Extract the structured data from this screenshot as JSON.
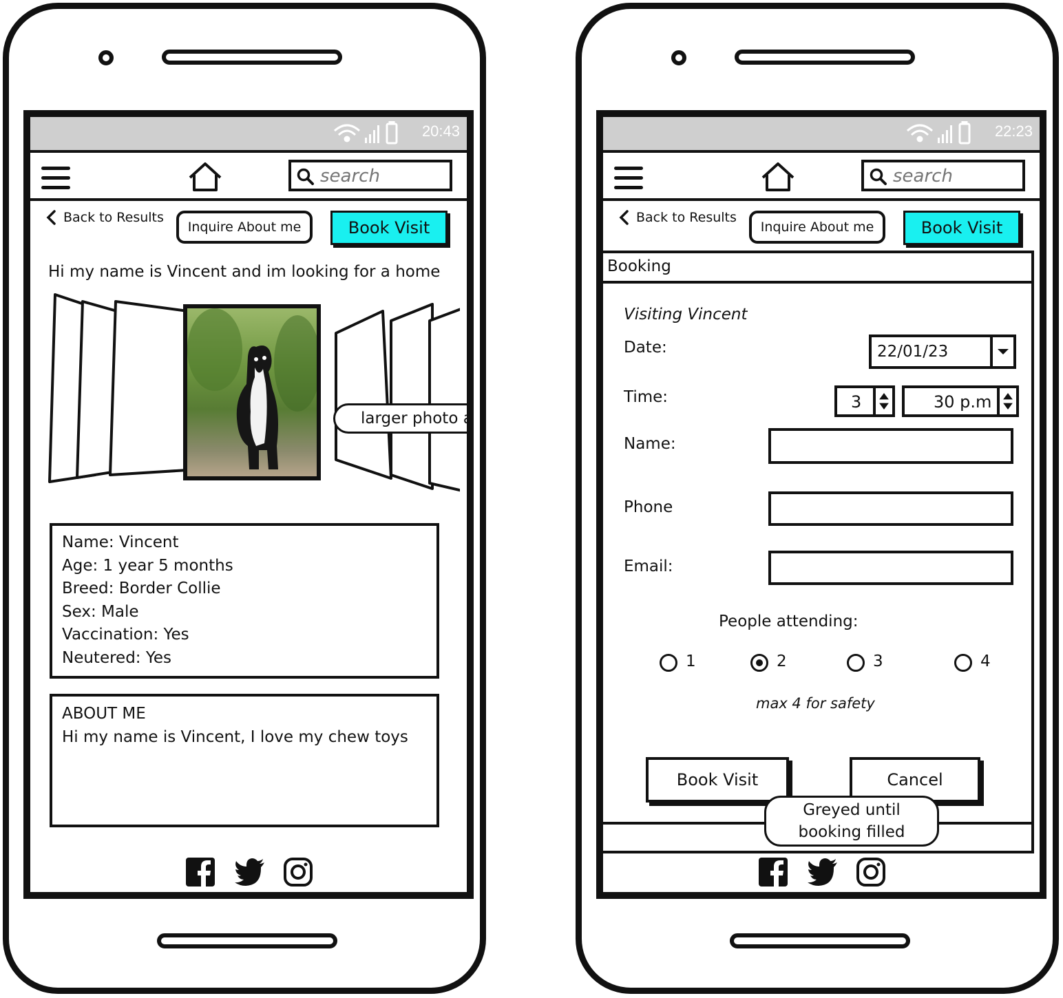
{
  "left_phone": {
    "status_time": "20:43",
    "search_placeholder": "search",
    "back_label": "Back to Results",
    "inquire_label": "Inquire About me",
    "book_label": "Book Visit",
    "headline": "Hi my name is Vincent and im looking for a home",
    "photo_callout": "larger photo area",
    "details": [
      "Name: Vincent",
      "Age: 1 year 5 months",
      "Breed: Border Collie",
      "Sex: Male",
      "Vaccination: Yes",
      "Neutered: Yes"
    ],
    "about_title": "ABOUT ME",
    "about_text": "Hi my name is Vincent, I love my chew toys"
  },
  "right_phone": {
    "status_time": "22:23",
    "search_placeholder": "search",
    "back_label": "Back to Results",
    "inquire_label": "Inquire About me",
    "book_label": "Book Visit",
    "panel_title": "Booking",
    "visiting": "Visiting Vincent",
    "date_label": "Date:",
    "date_value": "22/01/23",
    "time_label": "Time:",
    "time_hour": "3",
    "time_minute": "30 p.m",
    "name_label": "Name:",
    "phone_label": "Phone",
    "email_label": "Email:",
    "people_label": "People attending:",
    "people_options": [
      "1",
      "2",
      "3",
      "4"
    ],
    "people_selected": "2",
    "people_note": "max 4 for safety",
    "book_button": "Book Visit",
    "cancel_button": "Cancel",
    "callout": "Greyed until booking filled"
  },
  "icons": {
    "menu": "hamburger-icon",
    "home": "home-icon",
    "search": "search-icon",
    "back": "chevron-left-icon",
    "wifi": "wifi-icon",
    "signal": "signal-icon",
    "battery": "battery-icon",
    "facebook": "facebook-icon",
    "twitter": "twitter-icon",
    "instagram": "instagram-icon",
    "dropdown": "chevron-down-icon",
    "spinner": "stepper-icon"
  },
  "colors": {
    "accent": "#19f0f0",
    "statusbar": "#cfcfcf",
    "ink": "#111111"
  }
}
